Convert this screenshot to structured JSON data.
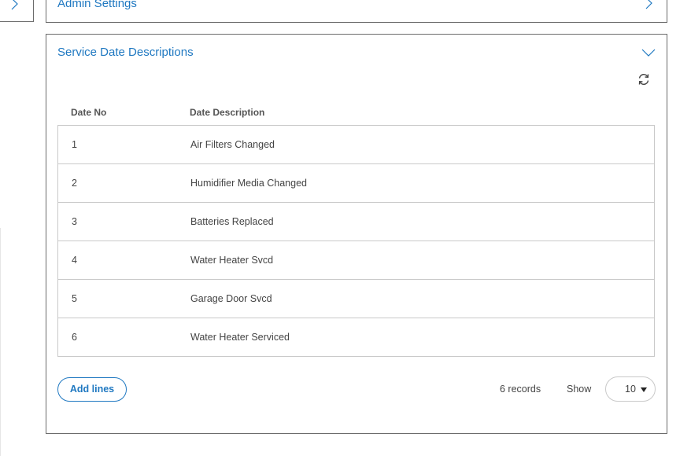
{
  "admin_panel": {
    "title": "Admin Settings"
  },
  "service_panel": {
    "title": "Service Date Descriptions",
    "columns": {
      "no": "Date No",
      "desc": "Date Description"
    },
    "rows": [
      {
        "no": "1",
        "desc": "Air Filters Changed"
      },
      {
        "no": "2",
        "desc": "Humidifier Media Changed"
      },
      {
        "no": "3",
        "desc": "Batteries Replaced"
      },
      {
        "no": "4",
        "desc": "Water Heater Svcd"
      },
      {
        "no": "5",
        "desc": "Garage Door Svcd"
      },
      {
        "no": "6",
        "desc": "Water Heater Serviced"
      }
    ],
    "add_button": "Add lines",
    "records": "6 records",
    "show_label": "Show",
    "page_size": "10"
  },
  "colors": {
    "accent": "#1f78c1",
    "border": "#6b6b6b",
    "row_border": "#c9c9c9"
  },
  "icons": [
    "chevron-right-icon",
    "chevron-down-icon",
    "refresh-icon",
    "caret-down-icon"
  ]
}
